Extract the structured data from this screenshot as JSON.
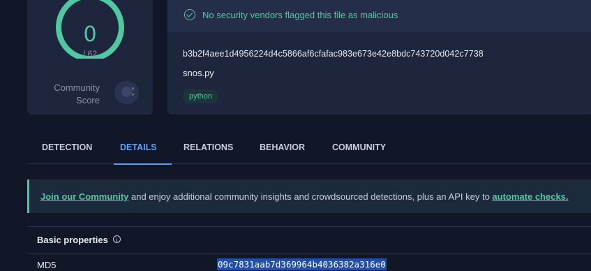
{
  "score": {
    "value": "0",
    "total": "/ 62",
    "community_label_line1": "Community",
    "community_label_line2": "Score",
    "ring_color": "#4ec9a0"
  },
  "summary": {
    "vendor_message": "No security vendors flagged this file as malicious",
    "hash": "b3b2f4aee1d4956224d4c5866af6cfafac983e673e42e8bdc743720d042c7738",
    "filename": "snos.py",
    "tags": [
      "python"
    ]
  },
  "tabs": [
    {
      "label": "DETECTION",
      "active": false
    },
    {
      "label": "DETAILS",
      "active": true
    },
    {
      "label": "RELATIONS",
      "active": false
    },
    {
      "label": "BEHAVIOR",
      "active": false
    },
    {
      "label": "COMMUNITY",
      "active": false
    }
  ],
  "banner": {
    "link1": "Join our Community",
    "middle": " and enjoy additional community insights and crowdsourced detections, plus an API key to ",
    "link2": "automate checks."
  },
  "basic_properties": {
    "title": "Basic properties",
    "rows": [
      {
        "key": "MD5",
        "value": "09c7831aab7d369964b4036382a316e0"
      }
    ]
  },
  "colors": {
    "accent_green": "#4ec9a0",
    "accent_blue": "#5aa2f5",
    "background": "#121728",
    "card": "#1e263d"
  }
}
